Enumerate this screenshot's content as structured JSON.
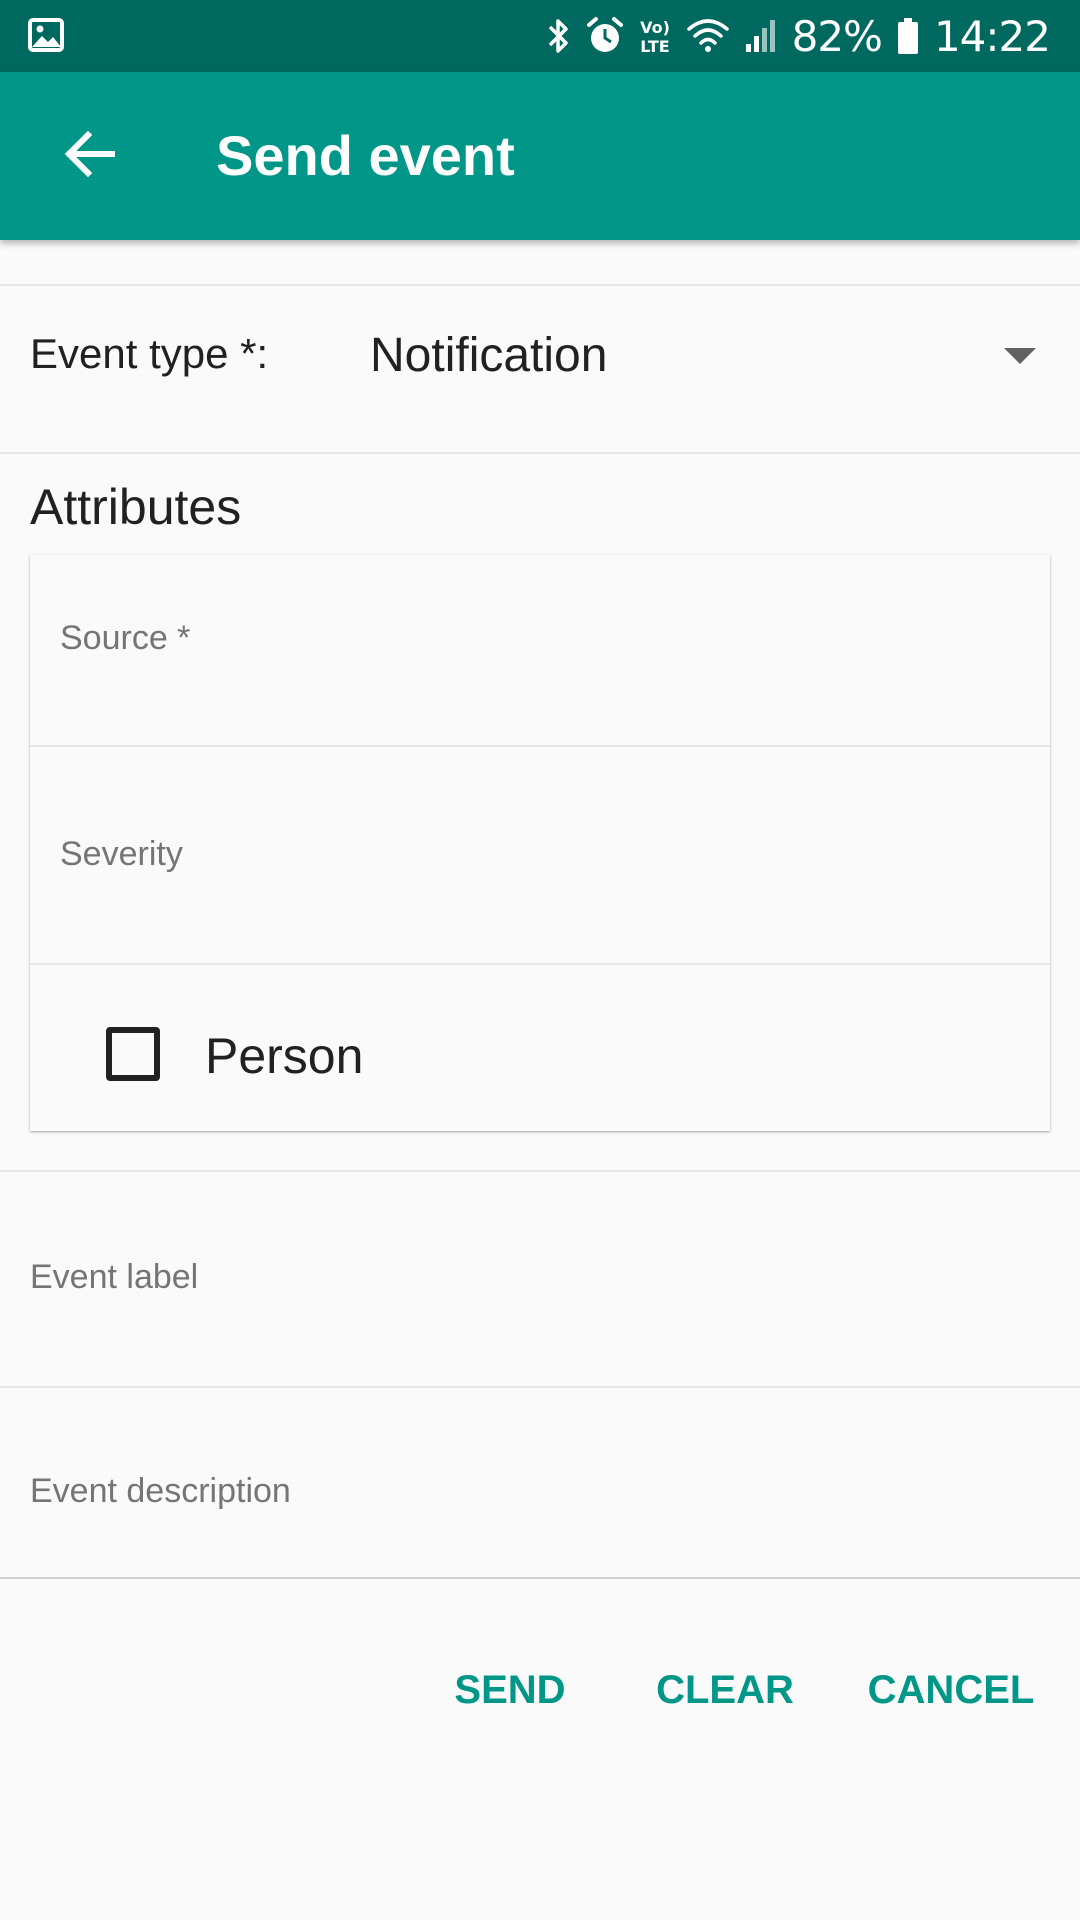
{
  "status_bar": {
    "battery": "82%",
    "time": "14:22",
    "icons": [
      "gallery-icon",
      "bluetooth-icon",
      "alarm-icon",
      "volte-icon",
      "wifi-icon",
      "signal-icon",
      "battery-icon"
    ],
    "volte_top": "Vo)",
    "volte_bottom": "LTE"
  },
  "app_bar": {
    "title": "Send event",
    "back_icon": "arrow-back-icon",
    "color": "#009688",
    "status_color": "#00695f"
  },
  "form": {
    "event_type_label": "Event type *:",
    "event_type_value": "Notification",
    "attributes_heading": "Attributes",
    "attributes": {
      "source_hint": "Source *",
      "source_value": "",
      "severity_hint": "Severity",
      "severity_value": "",
      "person_label": "Person",
      "person_checked": false
    },
    "event_label_hint": "Event label",
    "event_label_value": "",
    "event_description_hint": "Event description",
    "event_description_value": ""
  },
  "actions": {
    "send": "SEND",
    "clear": "CLEAR",
    "cancel": "CANCEL",
    "accent": "#009688"
  }
}
